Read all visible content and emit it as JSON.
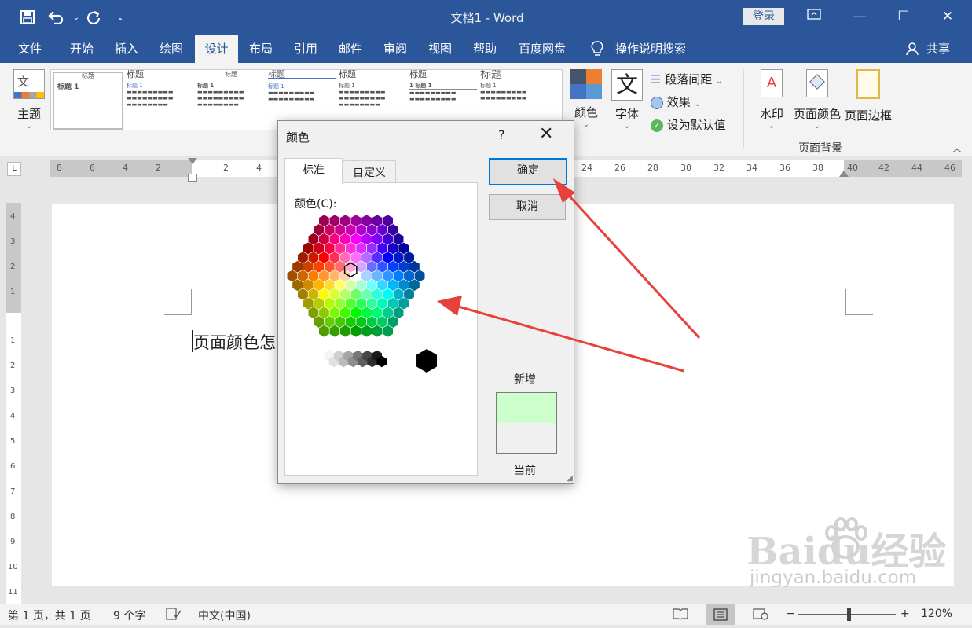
{
  "window": {
    "title": "文档1  -  Word",
    "login_label": "登录"
  },
  "tabs": [
    "文件",
    "开始",
    "插入",
    "绘图",
    "设计",
    "布局",
    "引用",
    "邮件",
    "审阅",
    "视图",
    "帮助",
    "百度网盘"
  ],
  "active_tab": "设计",
  "tell_me": "操作说明搜索",
  "share": "共享",
  "ribbon": {
    "theme": "主题",
    "thumbnails": [
      {
        "title": "标题",
        "subtitle": "标题 1"
      },
      {
        "title": "标题",
        "subtitle": "标题 1"
      },
      {
        "title": "标题",
        "subtitle": "标题 1"
      },
      {
        "title": "标题",
        "subtitle": "标题 1"
      },
      {
        "title": "标题",
        "subtitle": "标题 1"
      },
      {
        "title": "标题",
        "subtitle": "1  标题 1"
      },
      {
        "title": "标题",
        "subtitle": "标题 1"
      }
    ],
    "colors": "颜色",
    "fonts": "字体",
    "fonts_glyph": "文",
    "paragraph_spacing": "段落间距",
    "effects": "效果",
    "set_default": "设为默认值",
    "watermark": "水印",
    "page_color": "页面颜色",
    "page_borders": "页面边框",
    "group_page_background": "页面背景"
  },
  "ruler": {
    "left_labels": [
      "8",
      "6",
      "4",
      "2"
    ],
    "right_labels": [
      "2",
      "4",
      "24",
      "26",
      "28",
      "30",
      "32",
      "34",
      "36",
      "38",
      "40",
      "42",
      "44",
      "46"
    ],
    "vertical_labels": [
      "4",
      "3",
      "2",
      "1",
      "1",
      "2",
      "3",
      "4",
      "5",
      "6",
      "7",
      "8",
      "9",
      "10",
      "11"
    ]
  },
  "document": {
    "text": "页面颜色怎"
  },
  "status": {
    "page": "第 1 页，共 1 页",
    "words": "9 个字",
    "language": "中文(中国)",
    "zoom": "120%",
    "zoom_minus": "−",
    "zoom_plus": "+"
  },
  "dialog": {
    "title": "颜色",
    "help": "?",
    "close": "✕",
    "tabs": [
      "标准",
      "自定义"
    ],
    "color_label": "颜色(C):",
    "ok": "确定",
    "cancel": "取消",
    "new_label": "新增",
    "current_label": "当前",
    "new_color": "#ccffcc",
    "current_color": "#f0f0f0"
  },
  "colors": {
    "title_bar": "#2b579a",
    "annotation_arrow": "#e8413c"
  },
  "icons": {
    "save": "save-icon",
    "undo": "undo-icon",
    "redo": "redo-icon",
    "customize": "customize-toolbar-icon",
    "tell_me": "lightbulb-icon",
    "share": "person-icon"
  },
  "watermark": {
    "logo": "Baidu经验",
    "url": "jingyan.baidu.com"
  }
}
